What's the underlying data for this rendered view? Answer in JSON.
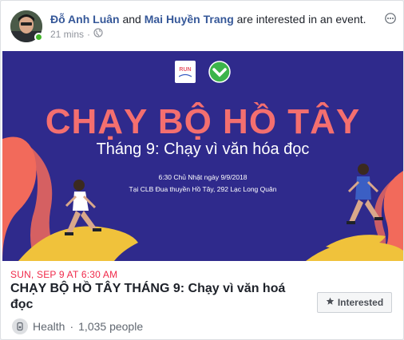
{
  "post": {
    "actor_1": "Đỗ Anh Luân",
    "connector": "and",
    "actor_2": "Mai Huyền Trang",
    "action": "are interested in an event.",
    "time": "21 mins",
    "separator": "·",
    "privacy_icon": "globe-icon"
  },
  "banner": {
    "badge_text": "RUN",
    "title": "CHẠY BỘ HỒ TÂY",
    "subtitle": "Tháng 9: Chạy vì văn hóa đọc",
    "time_line": "6:30 Chủ Nhật ngày 9/9/2018",
    "place_line": "Tại CLB Đua thuyền Hồ Tây, 292 Lạc Long Quân",
    "colors": {
      "background": "#2f2a8c",
      "title": "#f46f6f",
      "accent": "#f0c23b",
      "wave": "#f26a5b"
    }
  },
  "event": {
    "date": "SUN, SEP 9 AT 6:30 AM",
    "title": "CHẠY BỘ HỒ TÂY THÁNG 9: Chạy vì văn hoá đọc",
    "category": "Health",
    "dot": "·",
    "people": "1,035 people",
    "interested_label": "Interested",
    "interested_icon": "star-icon"
  },
  "colors": {
    "link": "#365899",
    "date_red": "#f02849",
    "online": "#42b72a"
  }
}
